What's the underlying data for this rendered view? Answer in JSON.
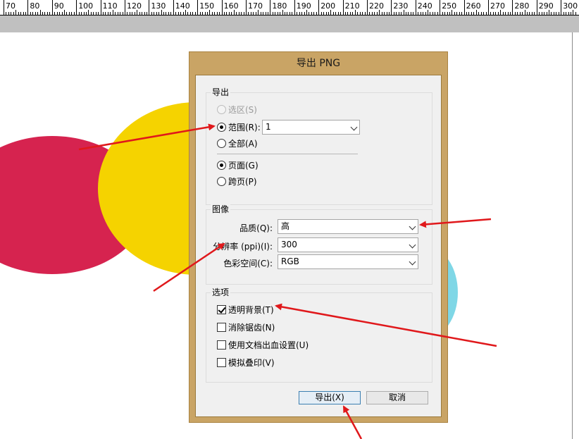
{
  "ruler": {
    "labels": [
      "70",
      "80",
      "90",
      "100",
      "110",
      "120",
      "130",
      "140",
      "150",
      "160",
      "170",
      "180",
      "190",
      "200",
      "210",
      "220",
      "230",
      "240",
      "250",
      "260",
      "270",
      "280",
      "290",
      "300"
    ]
  },
  "colors": {
    "circle_red": "#d6234f",
    "circle_yellow": "#f5d300",
    "circle_cyan": "#7fd7e6",
    "dialog_frame": "#c9a465",
    "arrow": "#e0181b"
  },
  "dialog": {
    "title": "导出 PNG",
    "export_group": {
      "title": "导出",
      "selection_label": "选区(S)",
      "range_label": "范围(R):",
      "range_value": "1",
      "all_label": "全部(A)",
      "pages_label": "页面(G)",
      "spreads_label": "跨页(P)"
    },
    "image_group": {
      "title": "图像",
      "quality_label": "品质(Q):",
      "quality_value": "高",
      "resolution_label": "分辨率 (ppi)(I):",
      "resolution_value": "300",
      "color_space_label": "色彩空间(C):",
      "color_space_value": "RGB"
    },
    "options_group": {
      "title": "选项",
      "transparent_bg": "透明背景(T)",
      "antialias": "消除锯齿(N)",
      "use_bleed": "使用文档出血设置(U)",
      "simulate_overprint": "模拟叠印(V)"
    },
    "buttons": {
      "export": "导出(X)",
      "cancel": "取消"
    }
  }
}
